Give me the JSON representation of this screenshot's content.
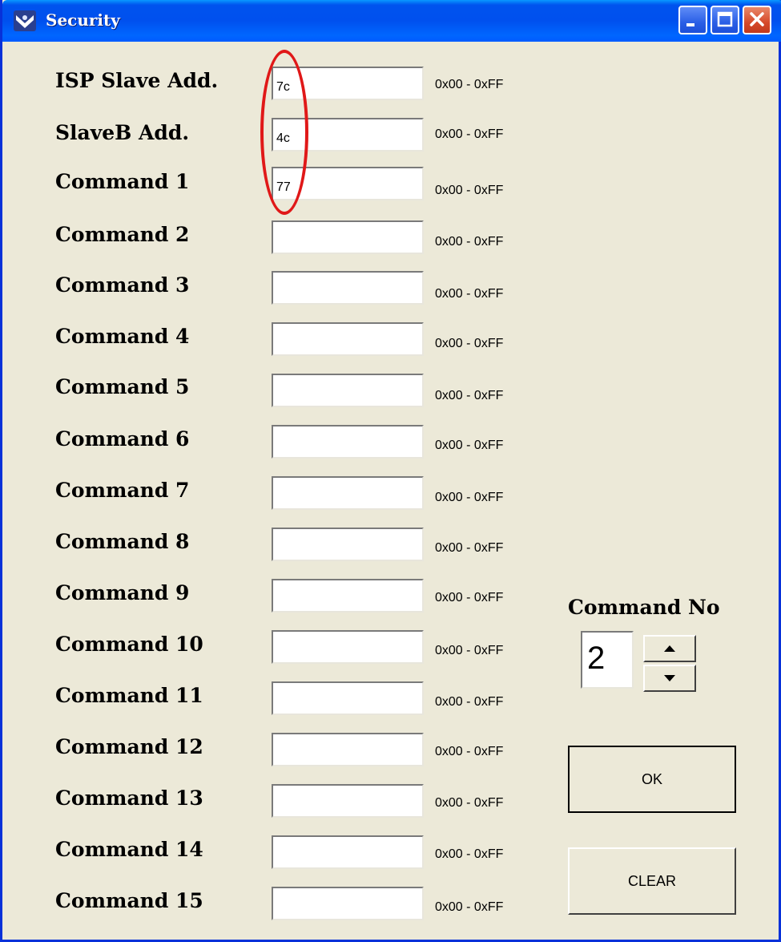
{
  "window": {
    "title": "Security"
  },
  "rows": [
    {
      "label": "ISP Slave Add.",
      "value": "7c",
      "range": "0x00 - 0xFF"
    },
    {
      "label": "SlaveB Add.",
      "value": "4c",
      "range": "0x00 - 0xFF"
    },
    {
      "label": "Command 1",
      "value": "77",
      "range": "0x00 - 0xFF"
    },
    {
      "label": "Command 2",
      "value": "",
      "range": "0x00 - 0xFF"
    },
    {
      "label": "Command 3",
      "value": "",
      "range": "0x00 - 0xFF"
    },
    {
      "label": "Command 4",
      "value": "",
      "range": "0x00 - 0xFF"
    },
    {
      "label": "Command 5",
      "value": "",
      "range": "0x00 - 0xFF"
    },
    {
      "label": "Command 6",
      "value": "",
      "range": "0x00 - 0xFF"
    },
    {
      "label": "Command 7",
      "value": "",
      "range": "0x00 - 0xFF"
    },
    {
      "label": "Command 8",
      "value": "",
      "range": "0x00 - 0xFF"
    },
    {
      "label": "Command 9",
      "value": "",
      "range": "0x00 - 0xFF"
    },
    {
      "label": "Command 10",
      "value": "",
      "range": "0x00 - 0xFF"
    },
    {
      "label": "Command 11",
      "value": "",
      "range": "0x00 - 0xFF"
    },
    {
      "label": "Command 12",
      "value": "",
      "range": "0x00 - 0xFF"
    },
    {
      "label": "Command 13",
      "value": "",
      "range": "0x00 - 0xFF"
    },
    {
      "label": "Command 14",
      "value": "",
      "range": "0x00 - 0xFF"
    },
    {
      "label": "Command 15",
      "value": "",
      "range": "0x00 - 0xFF"
    }
  ],
  "command_no": {
    "label": "Command No",
    "value": "2"
  },
  "buttons": {
    "ok": "OK",
    "clear": "CLEAR"
  },
  "colors": {
    "titlebar": "#0054e3",
    "window_bg": "#ece9d8",
    "annotation": "#e01818",
    "close_button": "#d6492a"
  }
}
